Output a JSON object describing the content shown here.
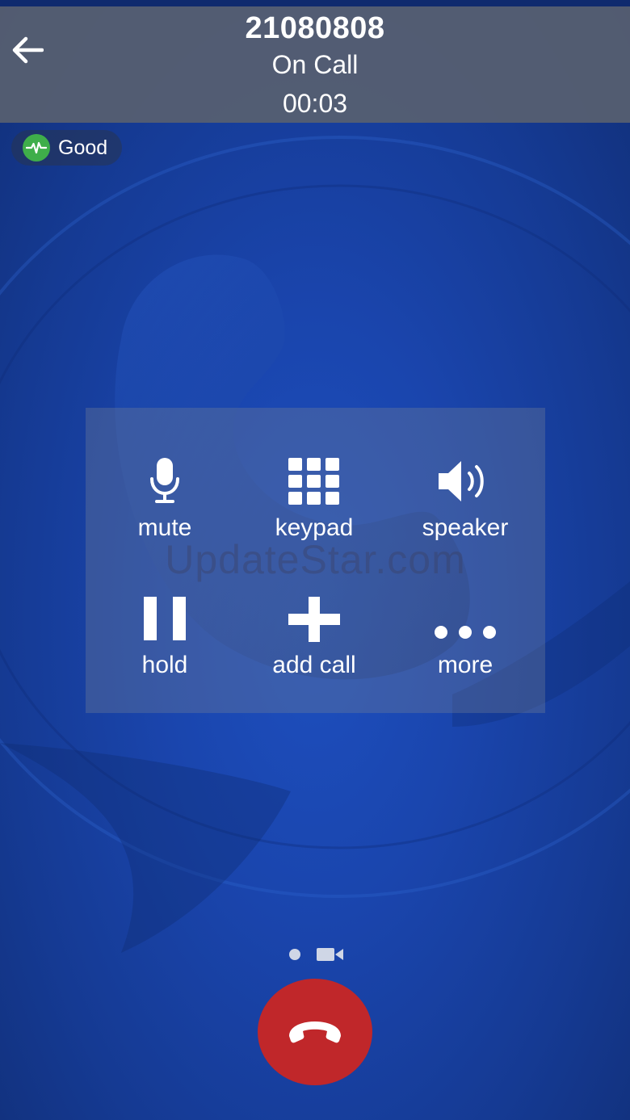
{
  "call": {
    "number": "21080808",
    "status": "On Call",
    "timer": "00:03"
  },
  "quality": {
    "label": "Good",
    "color": "#3fae4a"
  },
  "controls": {
    "mute": {
      "label": "mute",
      "icon": "microphone-icon"
    },
    "keypad": {
      "label": "keypad",
      "icon": "keypad-grid-icon"
    },
    "speaker": {
      "label": "speaker",
      "icon": "speaker-icon"
    },
    "hold": {
      "label": "hold",
      "icon": "pause-icon"
    },
    "add_call": {
      "label": "add call",
      "icon": "plus-icon"
    },
    "more": {
      "label": "more",
      "icon": "ellipsis-icon"
    }
  },
  "watermark": "UpdateStar.com",
  "end_call": {
    "icon": "phone-hangup-icon",
    "color": "#c0272a"
  },
  "pages": {
    "current_icon": "dot-icon",
    "video_icon": "video-camera-icon"
  }
}
